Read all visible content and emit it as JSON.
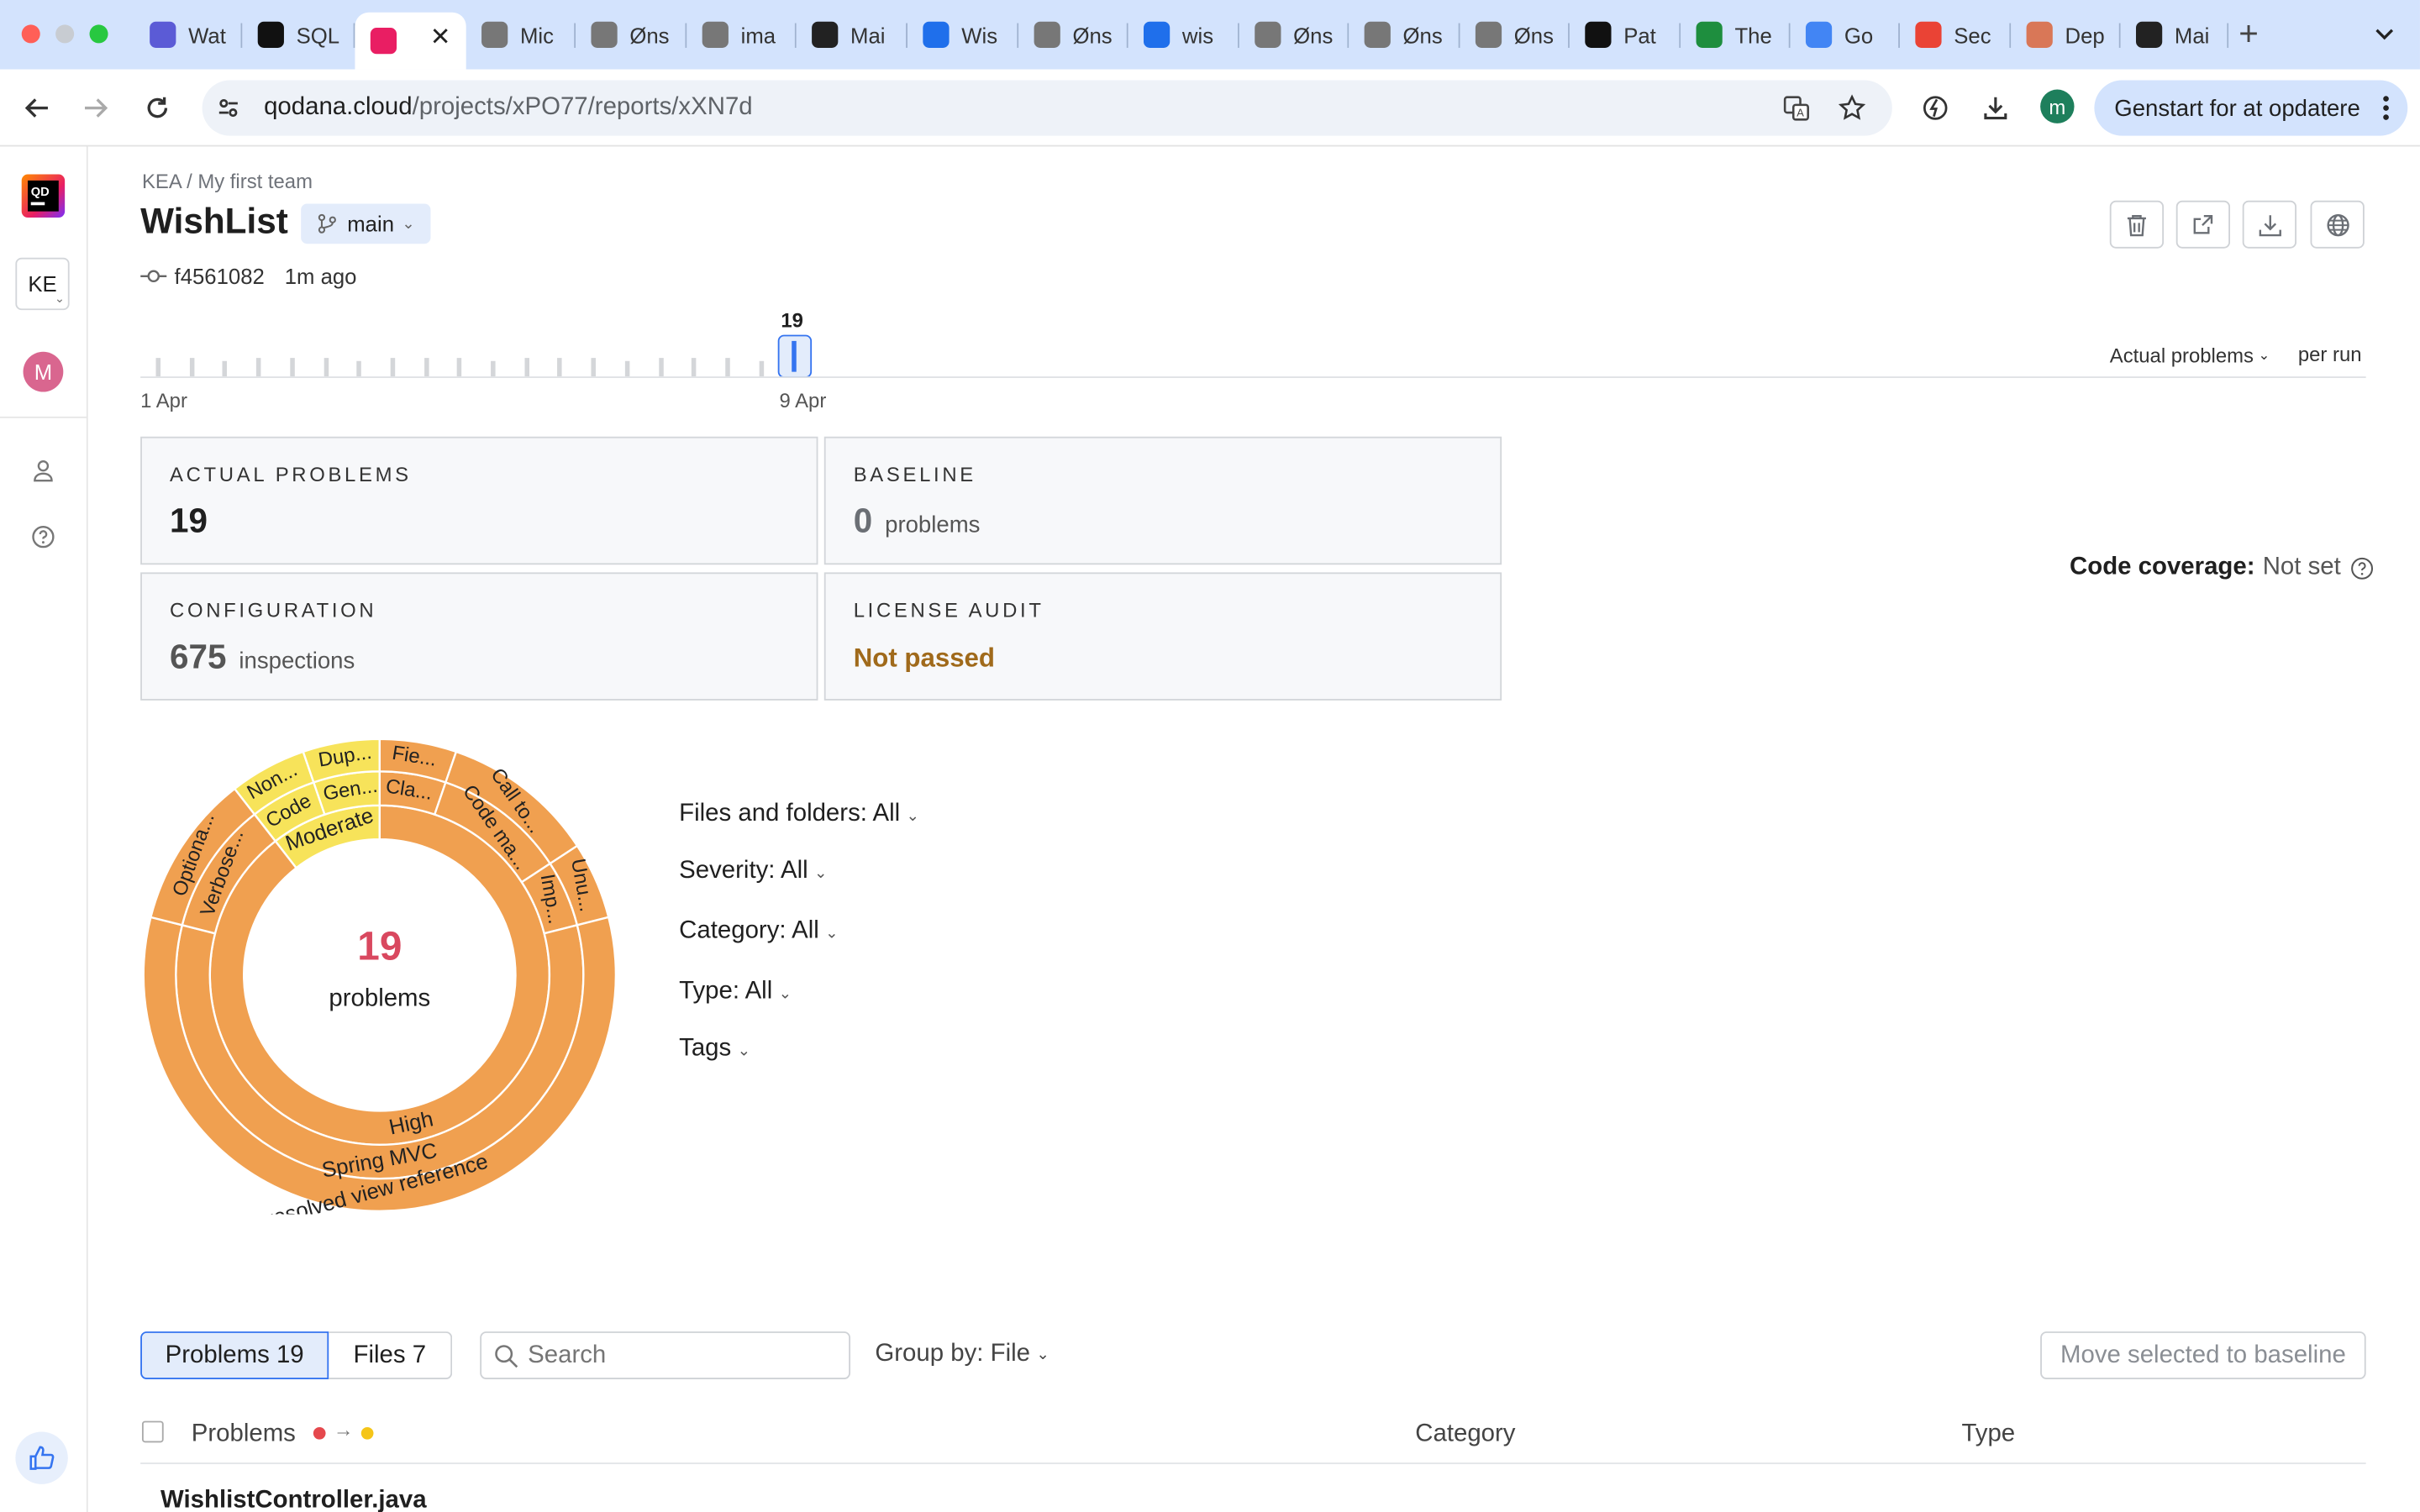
{
  "browser": {
    "tabs": [
      {
        "label": "Wat",
        "color": "#5b5bd6"
      },
      {
        "label": "SQL",
        "color": "#111111"
      },
      {
        "label": "",
        "color": "#e91e63",
        "active": true
      },
      {
        "label": "Mic",
        "color": "#777777"
      },
      {
        "label": "Øns",
        "color": "#777777"
      },
      {
        "label": "ima",
        "color": "#777777"
      },
      {
        "label": "Mai",
        "color": "#222222"
      },
      {
        "label": "Wis",
        "color": "#1f6feb"
      },
      {
        "label": "Øns",
        "color": "#777777"
      },
      {
        "label": "wis",
        "color": "#1f6feb"
      },
      {
        "label": "Øns",
        "color": "#777777"
      },
      {
        "label": "Øns",
        "color": "#777777"
      },
      {
        "label": "Øns",
        "color": "#777777"
      },
      {
        "label": "Pat",
        "color": "#111111"
      },
      {
        "label": "The",
        "color": "#1e8e3e"
      },
      {
        "label": "Go",
        "color": "#4285f4"
      },
      {
        "label": "Sec",
        "color": "#ea4335"
      },
      {
        "label": "Dep",
        "color": "#d97757"
      },
      {
        "label": "Mai",
        "color": "#222222"
      }
    ],
    "url_host": "qodana.cloud",
    "url_path": "/projects/xPO77/reports/xXN7d",
    "profile_initial": "m",
    "update_button": "Genstart for at opdatere"
  },
  "sidebar": {
    "team_badge": "KE",
    "avatar_initial": "M"
  },
  "header": {
    "breadcrumb": "KEA / My first team",
    "project": "WishList",
    "branch": "main",
    "commit_hash": "f4561082",
    "commit_age": "1m ago"
  },
  "timeline": {
    "selected_value": "19",
    "start_label": "1 Apr",
    "selected_label": "9 Apr",
    "metric_select": "Actual problems",
    "period": "per run"
  },
  "cards": {
    "actual": {
      "label": "ACTUAL PROBLEMS",
      "value": "19"
    },
    "baseline": {
      "label": "BASELINE",
      "value": "0",
      "unit": "problems"
    },
    "config": {
      "label": "CONFIGURATION",
      "value": "675",
      "unit": "inspections"
    },
    "license": {
      "label": "LICENSE AUDIT",
      "value": "Not passed"
    }
  },
  "coverage": {
    "label": "Code coverage:",
    "value": "Not set"
  },
  "sunburst": {
    "center_value": "19",
    "center_label": "problems",
    "colors": {
      "high": "#f0a050",
      "moderate": "#f7e35a",
      "border": "#ffffff",
      "center_value": "#d9485f"
    },
    "inner_labels": [
      "Moderate",
      "High"
    ],
    "middle_labels": [
      "Code",
      "Gen...",
      "Cla...",
      "Code ma...",
      "Imp...",
      "Spring MVC",
      "Verbose..."
    ],
    "outer_labels": [
      "Non...",
      "Dup...",
      "Fie...",
      "Call to...",
      "Unu...",
      "Unresolved view reference",
      "Optiona..."
    ]
  },
  "filters": {
    "files": "Files and folders: All",
    "severity": "Severity: All",
    "category": "Category: All",
    "type": "Type: All",
    "tags": "Tags"
  },
  "list": {
    "tab_problems": "Problems 19",
    "tab_files": "Files 7",
    "search_placeholder": "Search",
    "group_by": "Group by: File",
    "move_button": "Move selected to baseline",
    "col_problems": "Problems",
    "col_category": "Category",
    "col_type": "Type",
    "first_file": "WishlistController.java"
  }
}
